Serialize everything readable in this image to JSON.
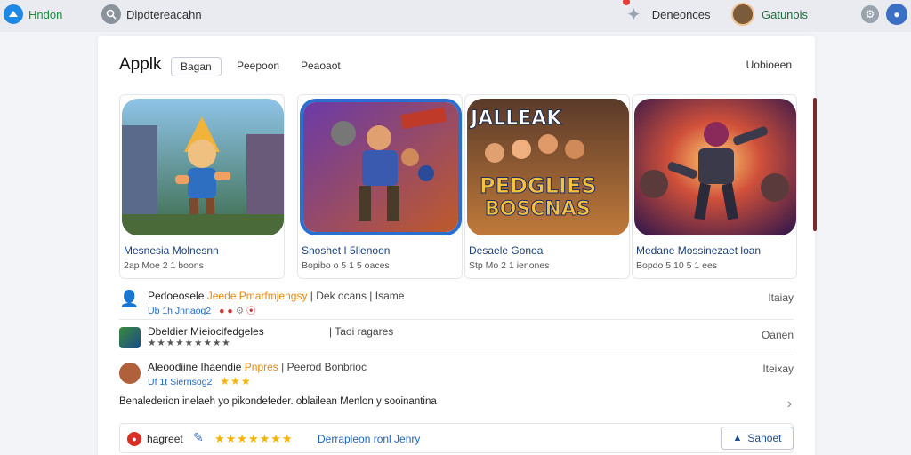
{
  "topbar": {
    "brand": "Hndon",
    "search_text": "Dipdtereacahn",
    "notifications_label": "Deneonces",
    "user_name": "Gatunois"
  },
  "main": {
    "heading": "Applk",
    "tabs": [
      {
        "label": "Bagan",
        "active": true
      },
      {
        "label": "Peepoon",
        "active": false
      },
      {
        "label": "Peaoaot",
        "active": false
      }
    ],
    "right_link": "Uobioeen"
  },
  "tiles": [
    {
      "title": "Mesnesia Molnesnn",
      "sub": "2ap Moe 2 1 boons",
      "art_text": ""
    },
    {
      "title": "Snoshet I 5lienoon",
      "sub": "Bopibo o 5 1 5 oaces",
      "art_text": ""
    },
    {
      "title": "Desaele Gonoa",
      "sub": "Stp Mo 2 1 ienones",
      "art_text_top": "JALLEAK",
      "art_text_main": "PEDGLIES",
      "art_text_bottom": "BOSCNAS"
    },
    {
      "title": "Medane Mossinezaet loan",
      "sub": "Bopdo 5 10 5 1 ees",
      "art_text": ""
    }
  ],
  "list": [
    {
      "title_a": "Pedoeosele",
      "title_b": "Jeede Pmarfmjengsy",
      "title_c": "| Dek ocans | Isame",
      "sub": "Ub 1h Jnnaog2",
      "right": "Itaiay"
    },
    {
      "title_a": "Dbeldier Mieiocifedgeles",
      "title_c": "| Taoi ragares",
      "stars": "★★★★★★★★★",
      "right": "Oanen"
    },
    {
      "title_a": "Aleoodiine Ihaendie",
      "title_b": "Pnpres",
      "title_c": "| Peerod Bonbrioc",
      "sub": "Uf 1t Siernsog2",
      "stars": "★★★",
      "right": "Iteixay"
    }
  ],
  "description": "Benalederion inelaeh yo pikondefeder. oblailean Menlon y sooinantina",
  "footer": {
    "label": "hagreet",
    "stars": "★★★★★★★",
    "meta": "Derrapleon ronl Jenry",
    "button_label": "Sanoet"
  },
  "colors": {
    "accent": "#1f67c1",
    "star": "#f4b400",
    "link_green": "#1e8e3e"
  }
}
